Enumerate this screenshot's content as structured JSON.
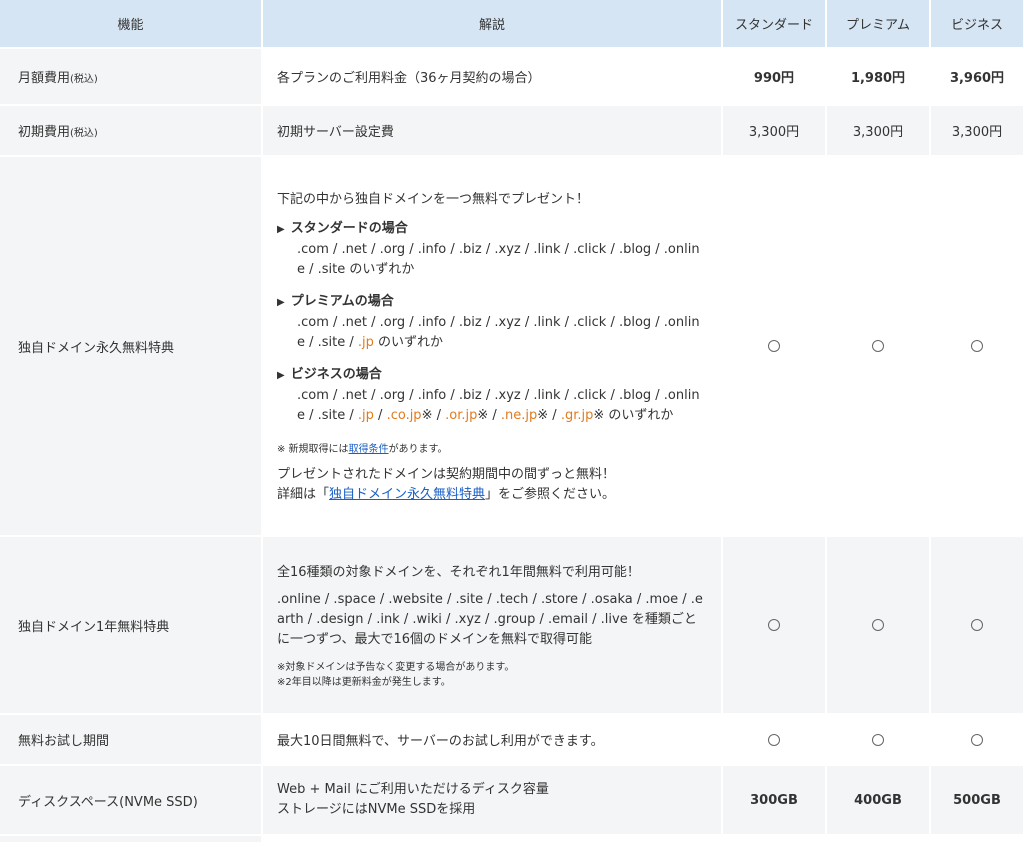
{
  "header": {
    "feature": "機能",
    "description": "解説",
    "standard": "スタンダード",
    "premium": "プレミアム",
    "business": "ビジネス"
  },
  "rows": {
    "monthly": {
      "feature": "月額費用",
      "feature_tax": "(税込)",
      "desc": "各プランのご利用料金（36ヶ月契約の場合）",
      "standard": "990円",
      "premium": "1,980円",
      "business": "3,960円"
    },
    "initial": {
      "feature": "初期費用",
      "feature_tax": "(税込)",
      "desc": "初期サーバー設定費",
      "standard": "3,300円",
      "premium": "3,300円",
      "business": "3,300円"
    },
    "domain_free": {
      "feature": "独自ドメイン永久無料特典",
      "intro": "下記の中から独自ドメインを一つ無料でプレゼント！",
      "standard_title": "スタンダードの場合",
      "standard_domains_1": ".com / .net / .org / .info / .biz / .xyz / .link / .click / .blog / .onlin",
      "standard_domains_2": "e / .site のいずれか",
      "premium_title": "プレミアムの場合",
      "premium_domains_1": ".com / .net / .org / .info / .biz / .xyz / .link / .click / .blog / .onlin",
      "premium_domains_2a": "e / .site / ",
      "premium_jp": ".jp",
      "premium_domains_2b": " のいずれか",
      "business_title": "ビジネスの場合",
      "business_domains_1": ".com / .net / .org / .info / .biz / .xyz / .link / .click / .blog / .onlin",
      "business_domains_2a": "e / .site / ",
      "business_jp": ".jp",
      "business_sep1": " / ",
      "business_cojp": ".co.jp",
      "business_mark1": "※ / ",
      "business_orjp": ".or.jp",
      "business_mark2": "※ / ",
      "business_nejp": ".ne.jp",
      "business_mark3": "※ / ",
      "business_grjp": ".gr.jp",
      "business_mark4": "※ のいずれか",
      "note_prefix": "※ 新規取得には",
      "note_link": "取得条件",
      "note_suffix": "があります。",
      "footer_1": "プレゼントされたドメインは契約期間中の間ずっと無料！",
      "footer_2_prefix": "詳細は「",
      "footer_2_link": "独自ドメイン永久無料特典",
      "footer_2_suffix": "」をご参照ください。",
      "standard": "○",
      "premium": "○",
      "business": "○"
    },
    "domain_1year": {
      "feature": "独自ドメイン1年無料特典",
      "intro": "全16種類の対象ドメインを、それぞれ1年間無料で利用可能！",
      "domains_1": ".online / .space / .website / .site / .tech / .store / .osaka / .moe / .e",
      "domains_2": "arth / .design / .ink / .wiki / .xyz / .group / .email / .live を種類ごと",
      "domains_3": "に一つずつ、最大で16個のドメインを無料で取得可能",
      "note_1": "※対象ドメインは予告なく変更する場合があります。",
      "note_2": "※2年目以降は更新料金が発生します。",
      "standard": "○",
      "premium": "○",
      "business": "○"
    },
    "trial": {
      "feature": "無料お試し期間",
      "desc": "最大10日間無料で、サーバーのお試し利用ができます。",
      "standard": "○",
      "premium": "○",
      "business": "○"
    },
    "disk": {
      "feature": "ディスクスペース(NVMe SSD)",
      "desc_1": "Web + Mail にご利用いただけるディスク容量",
      "desc_2": "ストレージにはNVMe SSDを採用",
      "standard": "300GB",
      "premium": "400GB",
      "business": "500GB"
    }
  },
  "colors": {
    "header_bg": "#d6e5f3",
    "row_alt_bg": "#f4f5f6",
    "accent_orange": "#e07b1f",
    "link_blue": "#1a5fc4"
  }
}
